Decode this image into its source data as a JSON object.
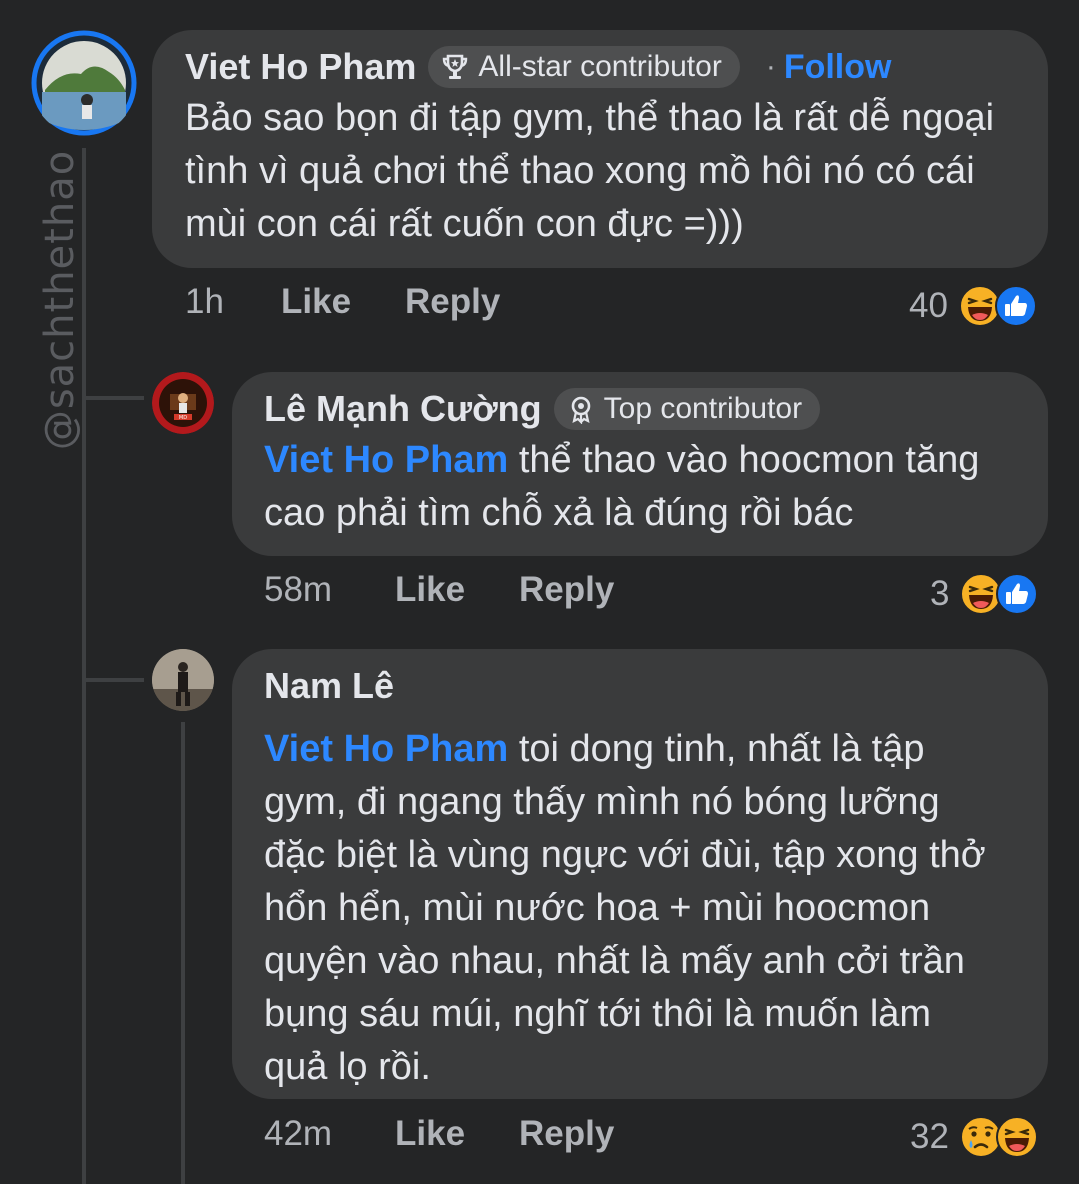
{
  "watermark": "@sachthethao",
  "comments": [
    {
      "author": "Viet Ho Pham",
      "badge": "All-star contributor",
      "separator": "·",
      "follow_label": "Follow",
      "text": "Bảo sao bọn đi tập gym, thể thao là rất dễ ngoại tình vì quả chơi thể thao xong mồ hôi nó có cái mùi con cái rất cuốn con đực =)))",
      "time": "1h",
      "like_label": "Like",
      "reply_label": "Reply",
      "reaction_count": "40",
      "reactions": [
        "haha-icon",
        "like-icon"
      ]
    },
    {
      "author": "Lê Mạnh Cường",
      "badge": "Top contributor",
      "mention": "Viet Ho Pham",
      "text": " thể thao vào hoocmon tăng cao phải tìm chỗ xả là đúng rồi bác",
      "time": "58m",
      "like_label": "Like",
      "reply_label": "Reply",
      "reaction_count": "3",
      "reactions": [
        "haha-icon",
        "like-icon"
      ]
    },
    {
      "author": "Nam Lê",
      "mention": "Viet Ho Pham",
      "text": " toi dong tinh, nhất là tập gym, đi ngang thấy mình nó bóng lưỡng đặc biệt là vùng ngực với đùi, tập xong thở hổn hển, mùi nước hoa + mùi hoocmon quyện vào nhau, nhất là mấy anh cởi trần bụng sáu múi, nghĩ tới thôi là muốn làm quả lọ rồi.",
      "time": "42m",
      "like_label": "Like",
      "reply_label": "Reply",
      "reaction_count": "32",
      "reactions": [
        "sad-icon",
        "haha-icon"
      ]
    }
  ],
  "colors": {
    "background": "#242526",
    "bubble": "#3a3b3c",
    "link": "#2d88ff",
    "secondary_text": "#b0b3b8"
  }
}
